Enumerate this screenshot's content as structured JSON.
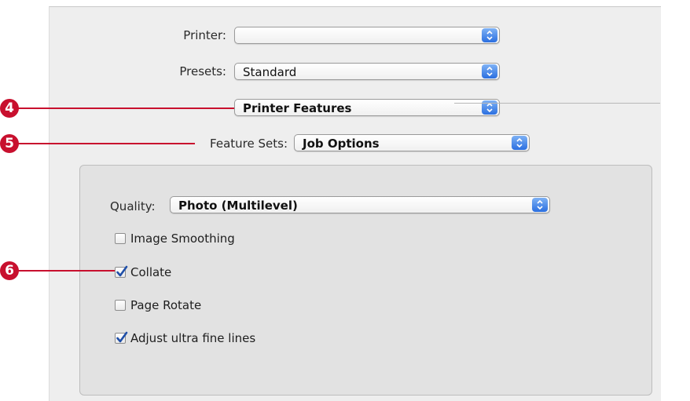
{
  "printer": {
    "label": "Printer:",
    "value": ""
  },
  "presets": {
    "label": "Presets:",
    "value": "Standard"
  },
  "panel_menu": {
    "value": "Printer Features"
  },
  "feature_sets": {
    "label": "Feature Sets:",
    "value": "Job Options"
  },
  "quality": {
    "label": "Quality:",
    "value": "Photo (Multilevel)"
  },
  "options": [
    {
      "label": "Image Smoothing",
      "checked": false
    },
    {
      "label": "Collate",
      "checked": true
    },
    {
      "label": "Page Rotate",
      "checked": false
    },
    {
      "label": "Adjust ultra fine lines",
      "checked": true
    }
  ],
  "callouts": [
    "4",
    "5",
    "6"
  ],
  "colors": {
    "callout_red": "#c8102e",
    "popup_arrow_blue": "#2b6fe0",
    "checkmark_blue": "#1f4fa8"
  }
}
